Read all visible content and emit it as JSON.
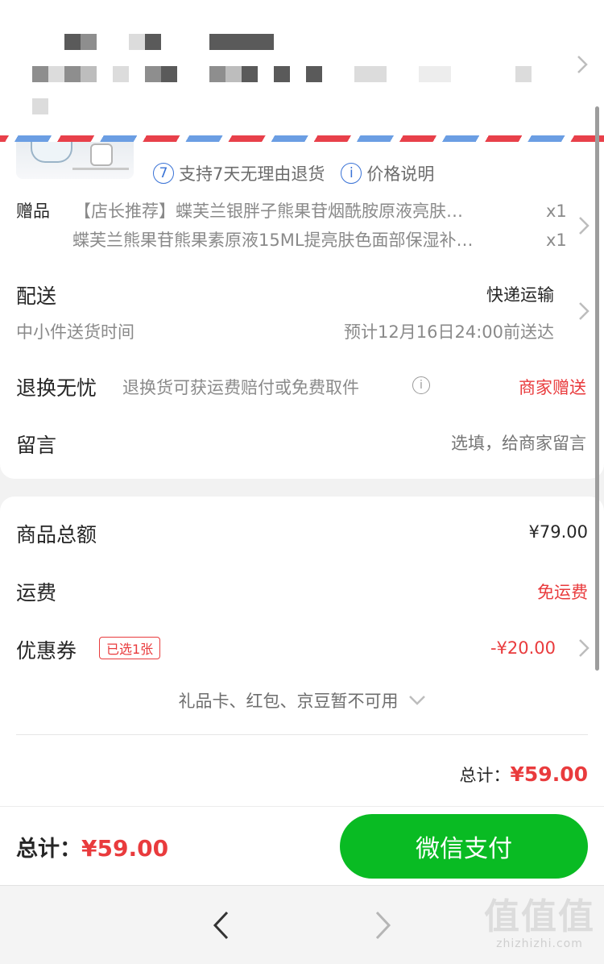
{
  "policy": {
    "return_badge": "7",
    "return_text": "支持7天无理由退货",
    "info_badge": "i",
    "price_text": "价格说明"
  },
  "gifts": {
    "label": "赠品",
    "items": [
      {
        "name": "【店长推荐】蝶芙兰银胖子熊果苷烟酰胺原液亮肤…",
        "qty": "x1"
      },
      {
        "name": "蝶芙兰熊果苷熊果素原液15ML提亮肤色面部保湿补…",
        "qty": "x1"
      }
    ]
  },
  "delivery": {
    "label": "配送",
    "method": "快递运输",
    "sub_label": "中小件送货时间",
    "eta": "预计12月16日24:00前送达"
  },
  "returns": {
    "label": "退换无忧",
    "desc": "退换货可获运费赔付或免费取件",
    "info_badge": "i",
    "status": "商家赠送"
  },
  "message": {
    "label": "留言",
    "placeholder": "选填，给商家留言"
  },
  "summary": {
    "goods_label": "商品总额",
    "goods_value": "¥79.00",
    "shipping_label": "运费",
    "shipping_value": "免运费",
    "coupon_label": "优惠券",
    "coupon_tag": "已选1张",
    "coupon_value": "-¥20.00",
    "unavailable_text": "礼品卡、红包、京豆暂不可用",
    "total_label": "总计：",
    "total_value": "¥59.00"
  },
  "paybar": {
    "total_label": "总计：",
    "total_value": "¥59.00",
    "pay_button": "微信支付"
  },
  "watermark": {
    "big": "值值值",
    "small": "zhizhizhi.com"
  },
  "colors": {
    "accent_red": "#e93b3d",
    "pay_green": "#09bb23",
    "info_blue": "#3a73d6"
  },
  "icons": [
    "chevron-right-icon",
    "chevron-down-icon",
    "info-icon",
    "back-arrow-icon",
    "forward-arrow-icon"
  ]
}
